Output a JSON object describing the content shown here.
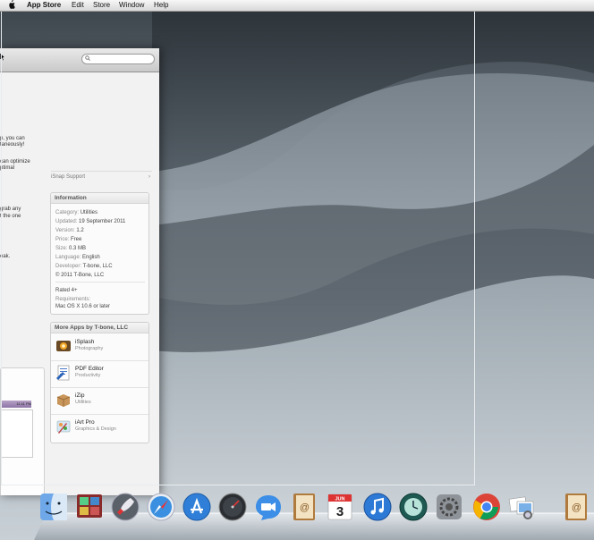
{
  "menubar": {
    "apple_glyph": "",
    "items": [
      "App Store",
      "Edit",
      "Store",
      "Window",
      "Help"
    ]
  },
  "search": {
    "placeholder": "",
    "icon": "magnifier-icon"
  },
  "description_lines": [
    "p, you can",
    "taneously!",
    "can optimize",
    "ptimal",
    "grab any",
    "t the one",
    "eak."
  ],
  "support": {
    "label": "iSnap Support",
    "chevron": "›"
  },
  "information": {
    "title": "Information",
    "category_key": "Category:",
    "category": "Utilities",
    "updated_key": "Updated:",
    "updated": "19 September 2011",
    "version_key": "Version:",
    "version": "1.2",
    "price_key": "Price:",
    "price": "Free",
    "size_key": "Size:",
    "size": "0.3 MB",
    "language_key": "Language:",
    "language": "English",
    "developer_key": "Developer:",
    "developer": "T-bone, LLC",
    "copyright": "© 2011 T-Bone, LLC",
    "rated": "Rated 4+",
    "requirements_key": "Requirements:",
    "requirements": "Mac OS X 10.6 or later"
  },
  "more_apps": {
    "title": "More Apps by T-bone, LLC",
    "apps": [
      {
        "name": "iSplash",
        "category": "Photography",
        "icon": "isplash-icon"
      },
      {
        "name": "PDF Editor",
        "category": "Productivity",
        "icon": "pdf-editor-icon"
      },
      {
        "name": "iZip",
        "category": "Utilities",
        "icon": "izip-icon"
      },
      {
        "name": "iArt Pro",
        "category": "Graphics & Design",
        "icon": "iart-pro-icon"
      }
    ]
  },
  "thumbnail": {
    "bar_text": "11:11 PM"
  },
  "calendar": {
    "month": "JUN",
    "day": "3"
  },
  "dock": [
    "finder-icon",
    "photo-booth-icon",
    "launchpad-icon",
    "safari-icon",
    "app-store-icon",
    "dashboard-icon",
    "facetime-icon",
    "address-book-icon",
    "ical-icon",
    "itunes-icon",
    "time-machine-icon",
    "system-preferences-icon",
    "chrome-icon",
    "preview-icon",
    "mail-icon"
  ],
  "colors": {
    "accent": "#3a7bd5",
    "wallpaper": "#8e99a2"
  }
}
